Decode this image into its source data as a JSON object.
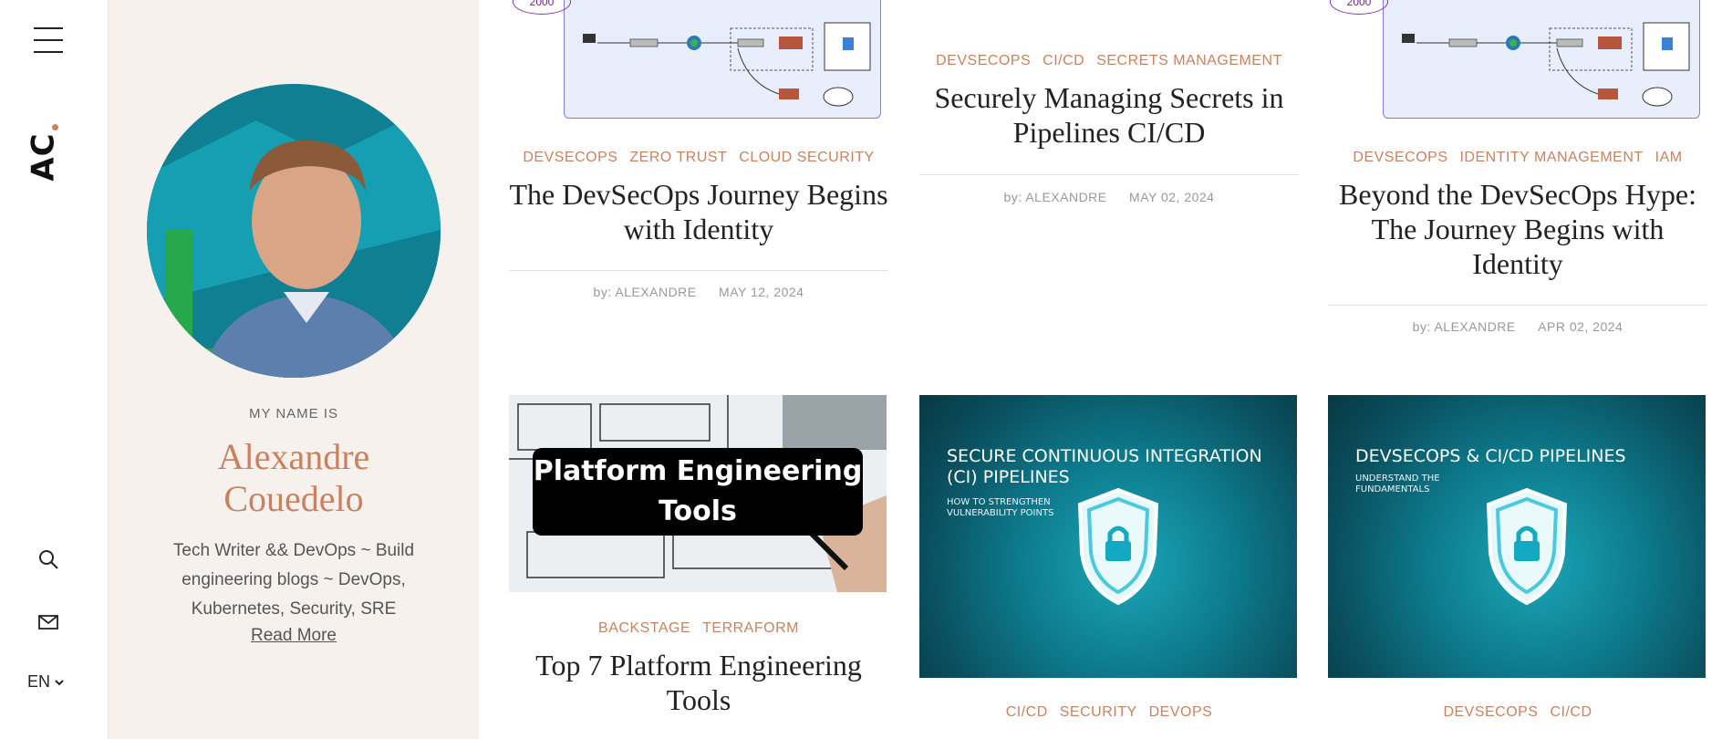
{
  "rail": {
    "logo": "AC",
    "lang": "EN"
  },
  "profile": {
    "my_name_is": "MY NAME IS",
    "name_line1": "Alexandre",
    "name_line2": "Couedelo",
    "bio": "Tech Writer && DevOps ~ Build engineering blogs ~ DevOps, Kubernetes, Security, SRE",
    "read_more": "Read More"
  },
  "posts": [
    {
      "tags": [
        "DEVSECOPS",
        "ZERO TRUST",
        "CLOUD SECURITY"
      ],
      "title": "The DevSecOps Journey Begins with Identity",
      "author": "by: ALEXANDRE",
      "date": "MAY 12, 2024",
      "diagram_badge": "2000"
    },
    {
      "tags": [
        "DEVSECOPS",
        "CI/CD",
        "SECRETS MANAGEMENT"
      ],
      "title": "Securely Managing Secrets in Pipelines CI/CD",
      "author": "by: ALEXANDRE",
      "date": "MAY 02, 2024"
    },
    {
      "tags": [
        "DEVSECOPS",
        "IDENTITY MANAGEMENT",
        "IAM"
      ],
      "title": "Beyond the DevSecOps Hype: The Journey Begins with Identity",
      "author": "by: ALEXANDRE",
      "date": "APR 02, 2024",
      "diagram_badge": "2000"
    },
    {
      "tags": [
        "BACKSTAGE",
        "TERRAFORM"
      ],
      "title": "Top 7 Platform Engineering Tools",
      "image_text_line1": "Platform Engineering",
      "image_text_line2": "Tools"
    },
    {
      "tags": [
        "CI/CD",
        "SECURITY",
        "DEVOPS"
      ],
      "image_title_line1": "SECURE CONTINUOUS INTEGRATION",
      "image_title_line2": "(CI) PIPELINES",
      "image_sub_line1": "HOW TO STRENGTHEN",
      "image_sub_line2": "VULNERABILITY POINTS"
    },
    {
      "tags": [
        "DEVSECOPS",
        "CI/CD"
      ],
      "image_title_line1": "DEVSECOPS & CI/CD PIPELINES",
      "image_sub_line1": "UNDERSTAND THE",
      "image_sub_line2": "FUNDAMENTALS"
    }
  ],
  "icons": {
    "menu": "menu-icon",
    "search": "search-icon",
    "mail": "mail-icon",
    "chevron": "chevron-down-icon",
    "lock": "lock-icon"
  },
  "colors": {
    "accent": "#c9825f",
    "profile_bg": "#f6f1ed",
    "teal": "#0d7b8d"
  }
}
